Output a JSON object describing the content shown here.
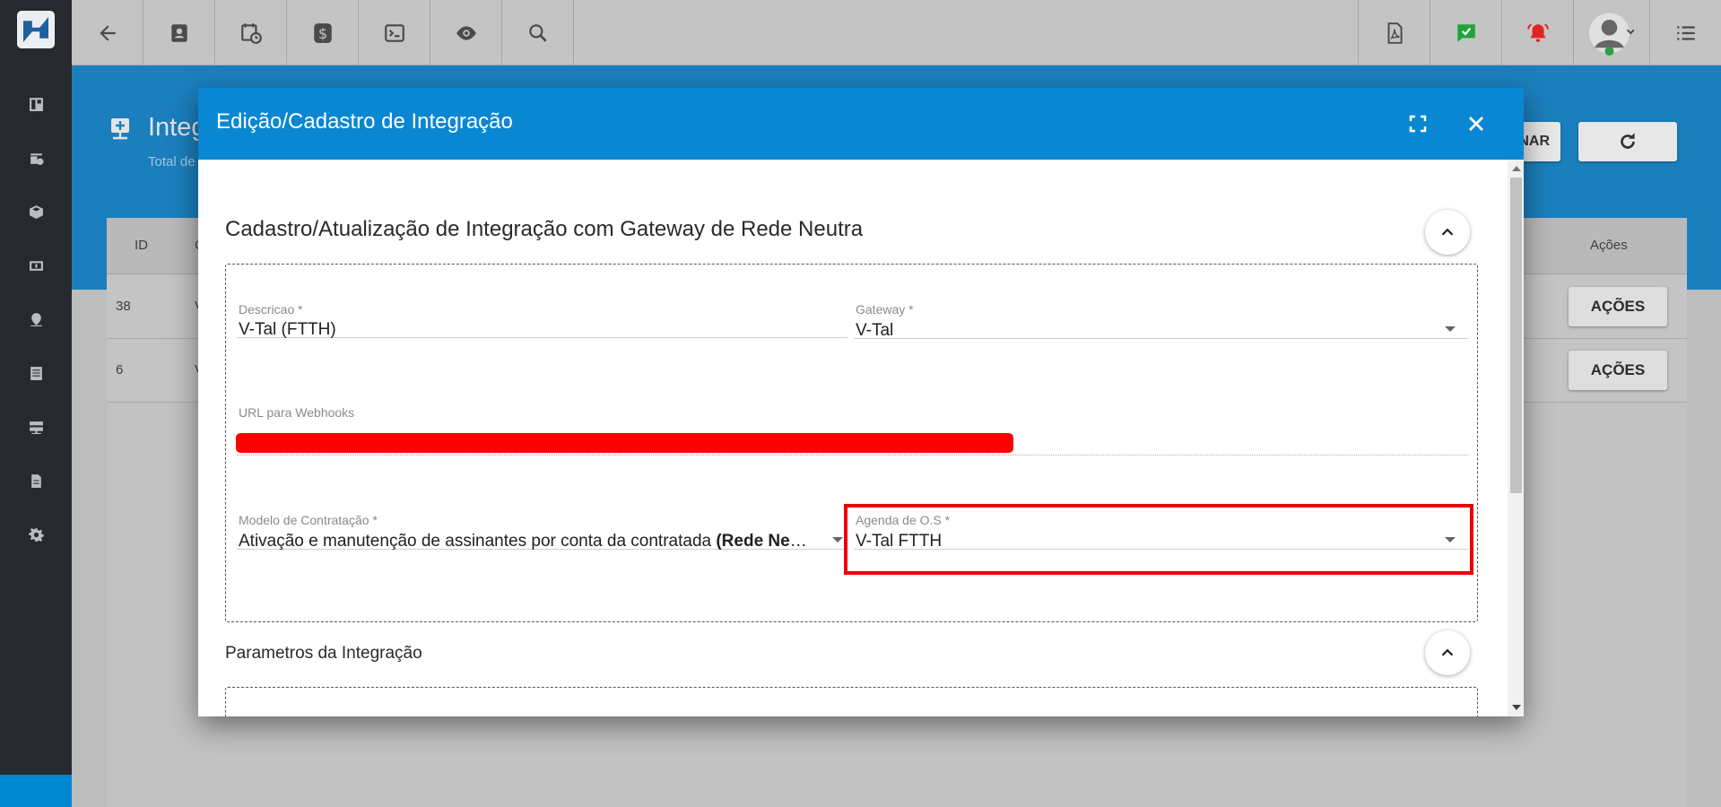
{
  "background": {
    "page_title": "Integ",
    "page_subtitle": "Total de",
    "button_partial": "NAR",
    "table": {
      "headers": {
        "id": "ID",
        "col2": "C",
        "actions": "Ações"
      },
      "rows": [
        {
          "id": "38",
          "col2": "V",
          "action": "AÇÕES"
        },
        {
          "id": "6",
          "col2": "V",
          "action": "AÇÕES"
        }
      ]
    },
    "sidebar_icons": [
      "dashboard-icon",
      "calendar-clock-icon",
      "box-icon",
      "money-icon",
      "map-pin-icon",
      "list-icon",
      "server-icon",
      "document-icon",
      "gear-icon"
    ],
    "toolbar_icons": [
      "back-arrow-icon",
      "contact-icon",
      "schedule-icon",
      "dollar-icon",
      "terminal-icon",
      "eye-icon",
      "search-icon"
    ],
    "toolbar_right_icons": [
      "pdf-icon",
      "chat-check-icon",
      "alarm-bell-icon",
      "user-avatar-icon",
      "menu-list-icon"
    ]
  },
  "modal": {
    "title": "Edição/Cadastro de Integração",
    "section1": {
      "title": "Cadastro/Atualização de Integração com Gateway de Rede Neutra",
      "fields": {
        "descricao": {
          "label": "Descricao",
          "required": "*",
          "value": "V-Tal (FTTH)"
        },
        "gateway": {
          "label": "Gateway",
          "required": "*",
          "value": "V-Tal"
        },
        "webhook": {
          "label": "URL para Webhooks"
        },
        "modelo": {
          "label": "Modelo de Contratação",
          "required": "*",
          "value_prefix": "Ativação e manutenção de assinantes por conta da contratada ",
          "value_bold": "(Rede Neutra)"
        },
        "agenda": {
          "label": "Agenda de O.S",
          "required": "*",
          "value": "V-Tal FTTH"
        }
      }
    },
    "section2": {
      "title": "Parametros da Integração"
    }
  },
  "colors": {
    "modal_header": "#0a87d3",
    "highlight": "#ee0000",
    "sidebar": "#26292e",
    "banner": "#1b7fbe"
  }
}
